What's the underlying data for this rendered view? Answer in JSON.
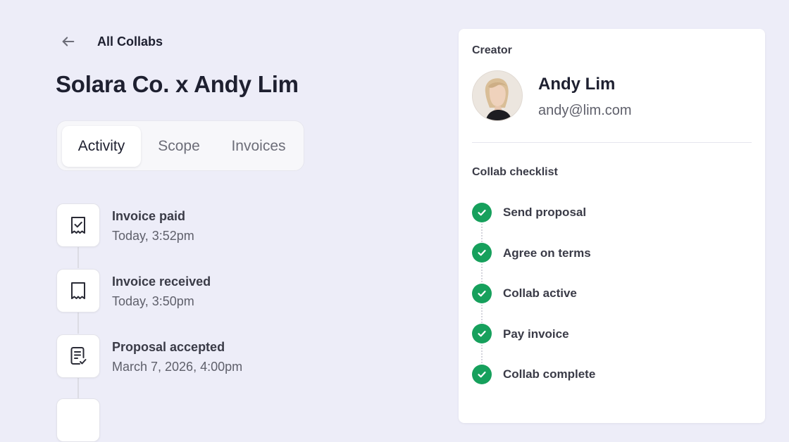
{
  "header": {
    "back_label": "All Collabs",
    "title": "Solara Co. x Andy Lim"
  },
  "tabs": [
    {
      "label": "Activity",
      "active": true
    },
    {
      "label": "Scope",
      "active": false
    },
    {
      "label": "Invoices",
      "active": false
    }
  ],
  "activity": [
    {
      "title": "Invoice paid",
      "time": "Today, 3:52pm",
      "icon": "receipt-check-icon"
    },
    {
      "title": "Invoice received",
      "time": "Today, 3:50pm",
      "icon": "receipt-icon"
    },
    {
      "title": "Proposal accepted",
      "time": "March 7, 2026, 4:00pm",
      "icon": "document-check-icon"
    }
  ],
  "creator": {
    "section_label": "Creator",
    "name": "Andy Lim",
    "email": "andy@lim.com"
  },
  "checklist": {
    "section_label": "Collab checklist",
    "items": [
      {
        "label": "Send proposal",
        "done": true
      },
      {
        "label": "Agree on terms",
        "done": true
      },
      {
        "label": "Collab active",
        "done": true
      },
      {
        "label": "Pay invoice",
        "done": true
      },
      {
        "label": "Collab complete",
        "done": true
      }
    ]
  },
  "colors": {
    "background": "#EDEDF8",
    "panel": "#FFFFFF",
    "check_green": "#16A05C",
    "text_primary": "#1E2030",
    "text_secondary": "#5F606B"
  }
}
